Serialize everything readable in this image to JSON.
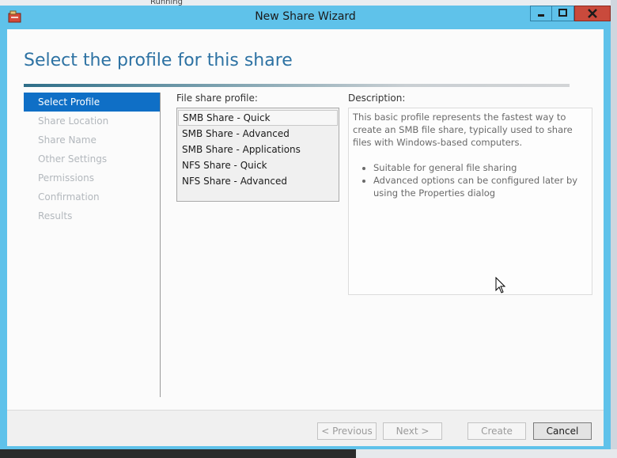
{
  "background": {
    "fragment_text": "Running"
  },
  "window": {
    "title": "New Share Wizard",
    "controls": [
      "minimize",
      "maximize",
      "close"
    ]
  },
  "page": {
    "heading": "Select the profile for this share"
  },
  "steps": [
    {
      "label": "Select Profile",
      "active": true
    },
    {
      "label": "Share Location",
      "active": false
    },
    {
      "label": "Share Name",
      "active": false
    },
    {
      "label": "Other Settings",
      "active": false
    },
    {
      "label": "Permissions",
      "active": false
    },
    {
      "label": "Confirmation",
      "active": false
    },
    {
      "label": "Results",
      "active": false
    }
  ],
  "profile": {
    "label": "File share profile:",
    "items": [
      "SMB Share - Quick",
      "SMB Share - Advanced",
      "SMB Share - Applications",
      "NFS Share - Quick",
      "NFS Share - Advanced"
    ],
    "selected": "SMB Share - Quick"
  },
  "description": {
    "label": "Description:",
    "text": "This basic profile represents the fastest way to create an SMB file share, typically used to share files with Windows-based computers.",
    "bullets": [
      "Suitable for general file sharing",
      "Advanced options can be configured later by using the Properties dialog"
    ]
  },
  "buttons": {
    "previous": "< Previous",
    "next": "Next >",
    "create": "Create",
    "cancel": "Cancel"
  },
  "colors": {
    "titlebar": "#5fc2ea",
    "active_step": "#0f6fc6",
    "heading": "#2d72a3",
    "close_button": "#c94a3c"
  }
}
